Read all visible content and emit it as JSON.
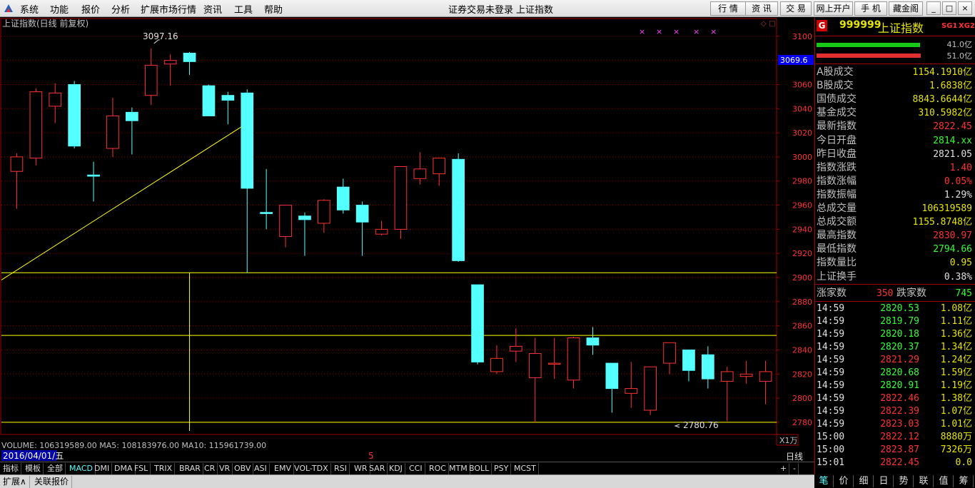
{
  "menubar": {
    "items": [
      "系统",
      "功能",
      "报价",
      "分析",
      "扩展市场行情",
      "资讯",
      "工具",
      "帮助"
    ],
    "center_text": "证券交易未登录",
    "center_title": "上证指数",
    "tool_buttons": [
      "行 情",
      "资 讯",
      "交 易",
      "网上开户",
      "手 机",
      "藏金阁"
    ],
    "window_buttons": [
      "_",
      "□",
      "×"
    ]
  },
  "chart": {
    "title": "上证指数(日线 前复权)",
    "high_label": "3097.16",
    "low_label": "2780.76",
    "current_price_tag": "3069.6",
    "volume_line": "VOLUME: 106319589.00  MA5: 108183976.00  MA10: 115961739.00",
    "date_label": "2016/04/01/五",
    "cursor_label": "5",
    "unit_label": "X1万",
    "period_label": "日线",
    "markers": [
      "×",
      "×",
      "×",
      "×",
      "×"
    ],
    "colors": {
      "up": "#ff3232",
      "down": "#54ffff",
      "grid": "#a00000",
      "guide": "#ffff00"
    }
  },
  "chart_data": {
    "type": "candlestick",
    "title": "上证指数(日线 前复权)",
    "y_ticks": [
      3100,
      3080,
      3060,
      3040,
      3020,
      3000,
      2980,
      2960,
      2940,
      2920,
      2900,
      2880,
      2860,
      2840,
      2820,
      2800,
      2780
    ],
    "y_range": [
      2777,
      3107
    ],
    "candles": [
      {
        "o": 2988,
        "h": 3003,
        "l": 2957,
        "c": 3000
      },
      {
        "o": 2999,
        "h": 3057,
        "l": 2993,
        "c": 3054
      },
      {
        "o": 3042,
        "h": 3061,
        "l": 3028,
        "c": 3053
      },
      {
        "o": 3060,
        "h": 3063,
        "l": 3007,
        "c": 3009
      },
      {
        "o": 2985,
        "h": 2996,
        "l": 2963,
        "c": 2984
      },
      {
        "o": 3007,
        "h": 3049,
        "l": 3000,
        "c": 3034
      },
      {
        "o": 3037,
        "h": 3041,
        "l": 3002,
        "c": 3030
      },
      {
        "o": 3051,
        "h": 3090,
        "l": 3043,
        "c": 3076
      },
      {
        "o": 3077,
        "h": 3085,
        "l": 3059,
        "c": 3080
      },
      {
        "o": 3086,
        "h": 3087,
        "l": 3068,
        "c": 3079
      },
      {
        "o": 3059,
        "h": 3060,
        "l": 3034,
        "c": 3034
      },
      {
        "o": 3051,
        "h": 3054,
        "l": 3027,
        "c": 3047
      },
      {
        "o": 3053,
        "h": 3056,
        "l": 2904,
        "c": 2974
      },
      {
        "o": 2954,
        "h": 2990,
        "l": 2940,
        "c": 2953
      },
      {
        "o": 2934,
        "h": 2960,
        "l": 2925,
        "c": 2960
      },
      {
        "o": 2951,
        "h": 2954,
        "l": 2918,
        "c": 2948
      },
      {
        "o": 2945,
        "h": 2965,
        "l": 2937,
        "c": 2964
      },
      {
        "o": 2975,
        "h": 2982,
        "l": 2953,
        "c": 2956
      },
      {
        "o": 2960,
        "h": 2963,
        "l": 2918,
        "c": 2946
      },
      {
        "o": 2936,
        "h": 2947,
        "l": 2935,
        "c": 2940
      },
      {
        "o": 2940,
        "h": 2992,
        "l": 2932,
        "c": 2992
      },
      {
        "o": 2982,
        "h": 3004,
        "l": 2977,
        "c": 2990
      },
      {
        "o": 2986,
        "h": 2999,
        "l": 2976,
        "c": 2999
      },
      {
        "o": 2998,
        "h": 3003,
        "l": 2913,
        "c": 2914
      },
      {
        "o": 2894,
        "h": 2894,
        "l": 2828,
        "c": 2830
      },
      {
        "o": 2822,
        "h": 2844,
        "l": 2820,
        "c": 2833
      },
      {
        "o": 2839,
        "h": 2858,
        "l": 2830,
        "c": 2843
      },
      {
        "o": 2817,
        "h": 2850,
        "l": 2780,
        "c": 2837
      },
      {
        "o": 2829,
        "h": 2850,
        "l": 2816,
        "c": 2829
      },
      {
        "o": 2815,
        "h": 2851,
        "l": 2808,
        "c": 2850
      },
      {
        "o": 2850,
        "h": 2859,
        "l": 2836,
        "c": 2844
      },
      {
        "o": 2829,
        "h": 2829,
        "l": 2788,
        "c": 2808
      },
      {
        "o": 2804,
        "h": 2830,
        "l": 2792,
        "c": 2808
      },
      {
        "o": 2790,
        "h": 2826,
        "l": 2786,
        "c": 2826
      },
      {
        "o": 2829,
        "h": 2846,
        "l": 2820,
        "c": 2846
      },
      {
        "o": 2840,
        "h": 2840,
        "l": 2814,
        "c": 2823
      },
      {
        "o": 2836,
        "h": 2843,
        "l": 2808,
        "c": 2816
      },
      {
        "o": 2814,
        "h": 2826,
        "l": 2781,
        "c": 2822
      },
      {
        "o": 2818,
        "h": 2831,
        "l": 2812,
        "c": 2820
      },
      {
        "o": 2814,
        "h": 2831,
        "l": 2795,
        "c": 2822
      }
    ],
    "horizontal_lines": [
      2904,
      2852,
      2780
    ],
    "trendline": {
      "from": [
        0,
        2898
      ],
      "to": [
        12,
        3028
      ]
    },
    "vertical_line_index": 9
  },
  "quote": {
    "code": "999999",
    "name": "上证指数",
    "tags": [
      "SG1",
      "XG2"
    ],
    "bar_values": [
      "41.0亿",
      "51.0亿"
    ],
    "rows": [
      [
        "A股成交",
        "1154.1910亿",
        "#e5e500"
      ],
      [
        "B股成交",
        "1.6838亿",
        "#e5e500"
      ],
      [
        "国债成交",
        "8843.6644亿",
        "#e5e500"
      ],
      [
        "基金成交",
        "310.5982亿",
        "#e5e500"
      ],
      [
        "最新指数",
        "2822.45",
        "#ff3232"
      ],
      [
        "今日开盘",
        "2814.xx",
        "#33ff33"
      ],
      [
        "昨日收盘",
        "2821.05",
        "#e0e0e0"
      ],
      [
        "指数涨跌",
        "1.40",
        "#ff3232"
      ],
      [
        "指数涨幅",
        "0.05%",
        "#ff3232"
      ],
      [
        "指数振幅",
        "1.29%",
        "#e0e0e0"
      ],
      [
        "总成交量",
        "106319589",
        "#e5e500"
      ],
      [
        "总成交额",
        "1155.8748亿",
        "#e5e500"
      ],
      [
        "最高指数",
        "2830.97",
        "#ff3232"
      ],
      [
        "最低指数",
        "2794.66",
        "#33ff33"
      ],
      [
        "指数量比",
        "0.95",
        "#e5e500"
      ],
      [
        "上证换手",
        "0.38%",
        "#e0e0e0"
      ]
    ],
    "advance_label": "涨家数",
    "advance": "350",
    "decline_label": "跌家数",
    "decline": "745",
    "ticks": [
      [
        "14:59",
        "2820.53",
        "#33ff33",
        "1.08亿"
      ],
      [
        "14:59",
        "2819.79",
        "#33ff33",
        "1.11亿"
      ],
      [
        "14:59",
        "2820.18",
        "#33ff33",
        "1.36亿"
      ],
      [
        "14:59",
        "2820.37",
        "#33ff33",
        "1.34亿"
      ],
      [
        "14:59",
        "2821.29",
        "#ff3232",
        "1.24亿"
      ],
      [
        "14:59",
        "2820.68",
        "#33ff33",
        "1.59亿"
      ],
      [
        "14:59",
        "2820.91",
        "#33ff33",
        "1.19亿"
      ],
      [
        "14:59",
        "2822.46",
        "#ff3232",
        "1.38亿"
      ],
      [
        "14:59",
        "2822.39",
        "#ff3232",
        "1.07亿"
      ],
      [
        "14:59",
        "2823.03",
        "#ff3232",
        "1.01亿"
      ],
      [
        "15:00",
        "2822.12",
        "#ff3232",
        "8880万"
      ],
      [
        "15:00",
        "2823.87",
        "#ff3232",
        "7326万"
      ],
      [
        "15:01",
        "2822.45",
        "#ff3232",
        "0.0"
      ]
    ]
  },
  "bottom_tabs": [
    "指标",
    "模板",
    "全部",
    "MACD",
    "DMI",
    "DMA",
    "FSL",
    "TRIX",
    "BRAR",
    "CR",
    "VR",
    "OBV",
    "ASI",
    "EMV",
    "VOL-TDX",
    "RSI",
    "WR",
    "SAR",
    "KDJ",
    "CCI",
    "ROC",
    "MTM",
    "BOLL",
    "PSY",
    "MCST"
  ],
  "status": [
    "扩展∧",
    "关联报价"
  ],
  "right_tabs": [
    "笔",
    "价",
    "细",
    "日",
    "势",
    "联",
    "值",
    "筹"
  ]
}
